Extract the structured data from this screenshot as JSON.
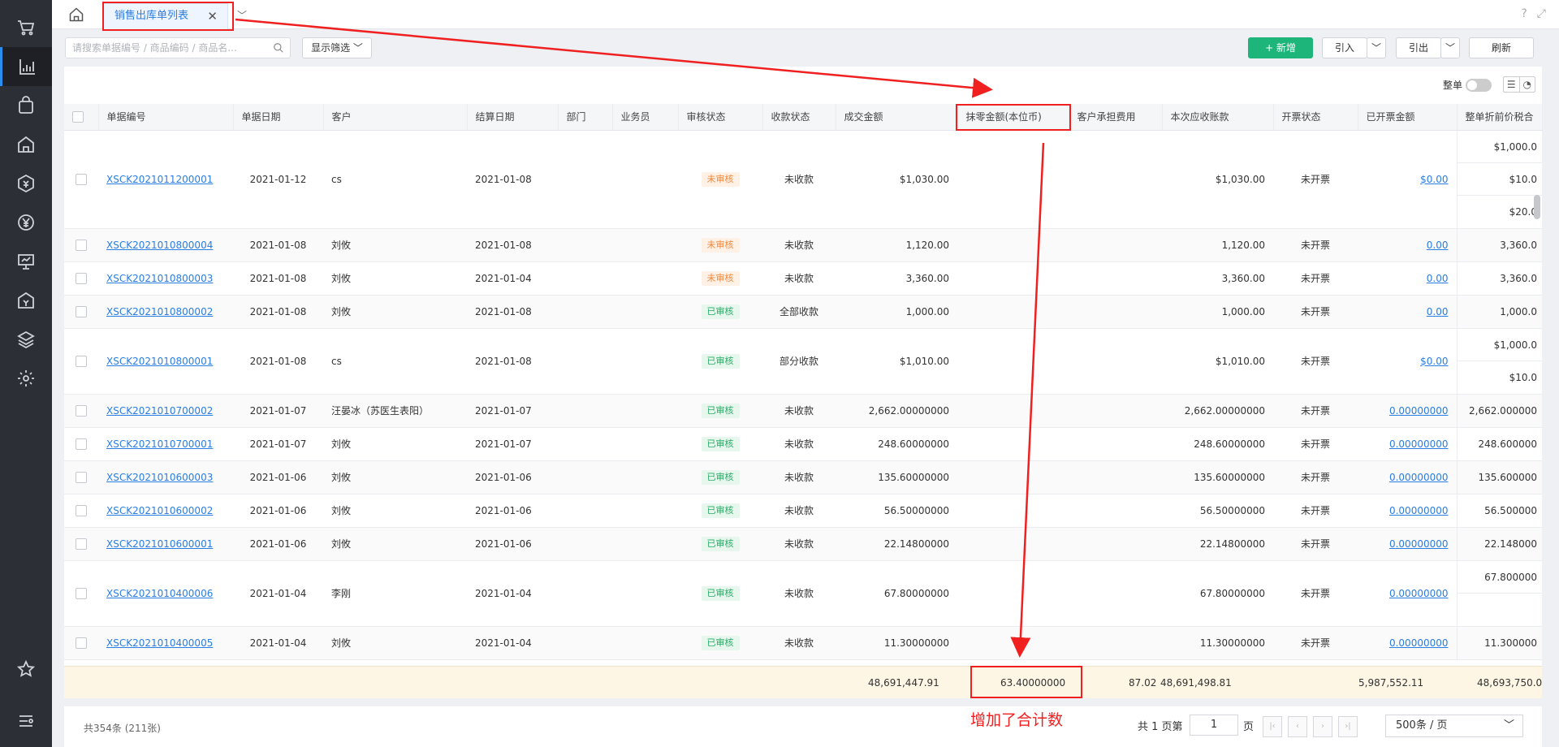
{
  "sidebar": {
    "items": [
      {
        "name": "cart-icon"
      },
      {
        "name": "report-chart-icon",
        "active": true
      },
      {
        "name": "bag-icon"
      },
      {
        "name": "warehouse-icon"
      },
      {
        "name": "finance-icon"
      },
      {
        "name": "yen-icon"
      },
      {
        "name": "presentation-icon"
      },
      {
        "name": "bank-icon"
      },
      {
        "name": "layers-icon"
      },
      {
        "name": "gear-icon"
      },
      {
        "name": "star-icon"
      },
      {
        "name": "settings-list-icon"
      }
    ]
  },
  "tabs": {
    "active_label": "销售出库单列表"
  },
  "toolbar": {
    "search_placeholder": "请搜索单据编号 / 商品编码 / 商品名...",
    "filter_label": "显示筛选",
    "add_label": "+ 新增",
    "import_label": "引入",
    "export_label": "引出",
    "refresh_label": "刷新",
    "whole_label": "整单"
  },
  "table": {
    "headers": [
      "单据编号",
      "单据日期",
      "客户",
      "结算日期",
      "部门",
      "业务员",
      "审核状态",
      "收款状态",
      "成交金额",
      "抹零金额(本位币)",
      "客户承担费用",
      "本次应收账款",
      "开票状态",
      "已开票金额",
      "整单折前价税合"
    ],
    "rows": [
      {
        "no": "XSCK2021011200001",
        "date": "2021-01-12",
        "customer": "cs",
        "settle": "2021-01-08",
        "audit": "未审核",
        "audit_ok": false,
        "pay": "未收款",
        "amount": "$1,030.00",
        "recv": "$1,030.00",
        "invoice": "未开票",
        "invoiced": "$0.00",
        "sub": [
          "$1,000.0",
          "$10.0",
          "$20.0"
        ]
      },
      {
        "no": "XSCK2021010800004",
        "date": "2021-01-08",
        "customer": "刘攸",
        "settle": "2021-01-08",
        "audit": "未审核",
        "audit_ok": false,
        "pay": "未收款",
        "amount": "1,120.00",
        "recv": "1,120.00",
        "invoice": "未开票",
        "invoiced": "0.00",
        "sub": [
          "3,360.0"
        ]
      },
      {
        "no": "XSCK2021010800003",
        "date": "2021-01-08",
        "customer": "刘攸",
        "settle": "2021-01-04",
        "audit": "未审核",
        "audit_ok": false,
        "pay": "未收款",
        "amount": "3,360.00",
        "recv": "3,360.00",
        "invoice": "未开票",
        "invoiced": "0.00",
        "sub": [
          "3,360.0"
        ]
      },
      {
        "no": "XSCK2021010800002",
        "date": "2021-01-08",
        "customer": "刘攸",
        "settle": "2021-01-08",
        "audit": "已审核",
        "audit_ok": true,
        "pay": "全部收款",
        "amount": "1,000.00",
        "recv": "1,000.00",
        "invoice": "未开票",
        "invoiced": "0.00",
        "sub": [
          "1,000.0"
        ]
      },
      {
        "no": "XSCK2021010800001",
        "date": "2021-01-08",
        "customer": "cs",
        "settle": "2021-01-08",
        "audit": "已审核",
        "audit_ok": true,
        "pay": "部分收款",
        "amount": "$1,010.00",
        "recv": "$1,010.00",
        "invoice": "未开票",
        "invoiced": "$0.00",
        "sub": [
          "$1,000.0",
          "$10.0"
        ]
      },
      {
        "no": "XSCK2021010700002",
        "date": "2021-01-07",
        "customer": "汪晏冰（苏医生表阳）",
        "settle": "2021-01-07",
        "audit": "已审核",
        "audit_ok": true,
        "pay": "未收款",
        "amount": "2,662.00000000",
        "recv": "2,662.00000000",
        "invoice": "未开票",
        "invoiced": "0.00000000",
        "sub": [
          "2,662.000000"
        ]
      },
      {
        "no": "XSCK2021010700001",
        "date": "2021-01-07",
        "customer": "刘攸",
        "settle": "2021-01-07",
        "audit": "已审核",
        "audit_ok": true,
        "pay": "未收款",
        "amount": "248.60000000",
        "recv": "248.60000000",
        "invoice": "未开票",
        "invoiced": "0.00000000",
        "sub": [
          "248.600000"
        ]
      },
      {
        "no": "XSCK2021010600003",
        "date": "2021-01-06",
        "customer": "刘攸",
        "settle": "2021-01-06",
        "audit": "已审核",
        "audit_ok": true,
        "pay": "未收款",
        "amount": "135.60000000",
        "recv": "135.60000000",
        "invoice": "未开票",
        "invoiced": "0.00000000",
        "sub": [
          "135.600000"
        ]
      },
      {
        "no": "XSCK2021010600002",
        "date": "2021-01-06",
        "customer": "刘攸",
        "settle": "2021-01-06",
        "audit": "已审核",
        "audit_ok": true,
        "pay": "未收款",
        "amount": "56.50000000",
        "recv": "56.50000000",
        "invoice": "未开票",
        "invoiced": "0.00000000",
        "sub": [
          "56.500000"
        ]
      },
      {
        "no": "XSCK2021010600001",
        "date": "2021-01-06",
        "customer": "刘攸",
        "settle": "2021-01-06",
        "audit": "已审核",
        "audit_ok": true,
        "pay": "未收款",
        "amount": "22.14800000",
        "recv": "22.14800000",
        "invoice": "未开票",
        "invoiced": "0.00000000",
        "sub": [
          "22.148000"
        ]
      },
      {
        "no": "XSCK2021010400006",
        "date": "2021-01-04",
        "customer": "李刚",
        "settle": "2021-01-04",
        "audit": "已审核",
        "audit_ok": true,
        "pay": "未收款",
        "amount": "67.80000000",
        "recv": "67.80000000",
        "invoice": "未开票",
        "invoiced": "0.00000000",
        "sub": [
          "67.800000",
          ""
        ]
      },
      {
        "no": "XSCK2021010400005",
        "date": "2021-01-04",
        "customer": "刘攸",
        "settle": "2021-01-04",
        "audit": "已审核",
        "audit_ok": true,
        "pay": "未收款",
        "amount": "11.30000000",
        "recv": "11.30000000",
        "invoice": "未开票",
        "invoiced": "0.00000000",
        "sub": [
          "11.300000"
        ]
      }
    ]
  },
  "summary": {
    "amount": "48,691,447.91",
    "round_off": "63.40000000",
    "customer_fee": "87.02",
    "receivable": "48,691,498.81",
    "invoiced": "5,987,552.11",
    "pre_discount": "48,693,750.0"
  },
  "footer": {
    "count": "共354条 (211张)",
    "annotation": "增加了合计数",
    "pages": "共 1 页第",
    "page_input": "1",
    "page_suffix": "页",
    "page_size": "500条 / 页"
  },
  "colors": {
    "accent": "#2a7de1",
    "green": "#1db57a",
    "annotation": "#f02020"
  }
}
